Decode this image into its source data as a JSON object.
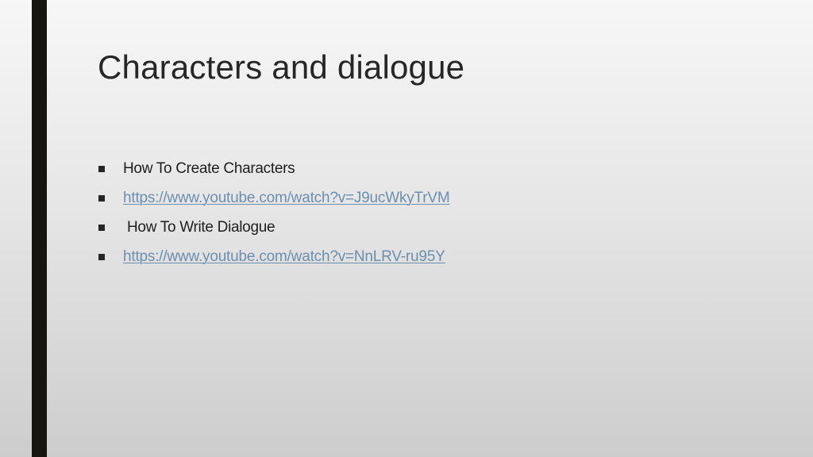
{
  "slide": {
    "title": "Characters and dialogue",
    "bullets": [
      {
        "text": "How To Create Characters",
        "type": "text"
      },
      {
        "text": "https://www.youtube.com/watch?v=J9ucWkyTrVM",
        "type": "link"
      },
      {
        "text": "How To Write Dialogue",
        "type": "text"
      },
      {
        "text": "https://www.youtube.com/watch?v=NnLRV-ru95Y",
        "type": "link"
      }
    ]
  },
  "colors": {
    "accent_bar": "#16160f",
    "title_text": "#262626",
    "body_text": "#1e1e1e",
    "link_text": "#6c8fb0"
  }
}
